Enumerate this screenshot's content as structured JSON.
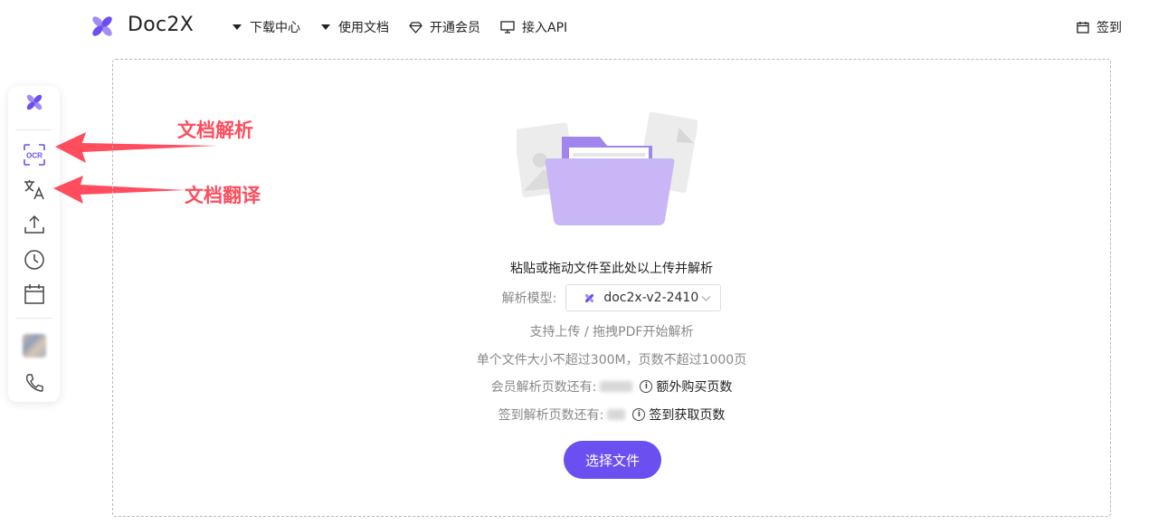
{
  "header": {
    "brand": "Doc2X",
    "nav": [
      {
        "label": "下载中心",
        "icon": "caret-down-icon"
      },
      {
        "label": "使用文档",
        "icon": "caret-down-icon"
      },
      {
        "label": "开通会员",
        "icon": "diamond-icon"
      },
      {
        "label": "接入API",
        "icon": "monitor-icon"
      }
    ],
    "signin_label": "签到"
  },
  "sidebar": {
    "items": [
      "logo-icon",
      "ocr-icon",
      "translate-icon",
      "upload-icon",
      "history-icon",
      "calendar-icon",
      "avatar",
      "phone-icon"
    ]
  },
  "annotations": {
    "ocr": "文档解析",
    "translate": "文档翻译"
  },
  "main": {
    "prompt": "粘贴或拖动文件至此处以上传并解析",
    "model_label": "解析模型:",
    "model_value": "doc2x-v2-2410",
    "support_text": "支持上传 / 拖拽PDF开始解析",
    "limit_text": "单个文件大小不超过300M，页数不超过1000页",
    "member_quota_label": "会员解析页数还有:",
    "member_quota_link": "额外购买页数",
    "signin_quota_label": "签到解析页数还有:",
    "signin_quota_link": "签到获取页数",
    "choose_button": "选择文件"
  },
  "colors": {
    "accent": "#6b4ff0",
    "annotation": "#ff4d5e",
    "folder": "#c9b6f7",
    "folder_back": "#9f85ec"
  }
}
